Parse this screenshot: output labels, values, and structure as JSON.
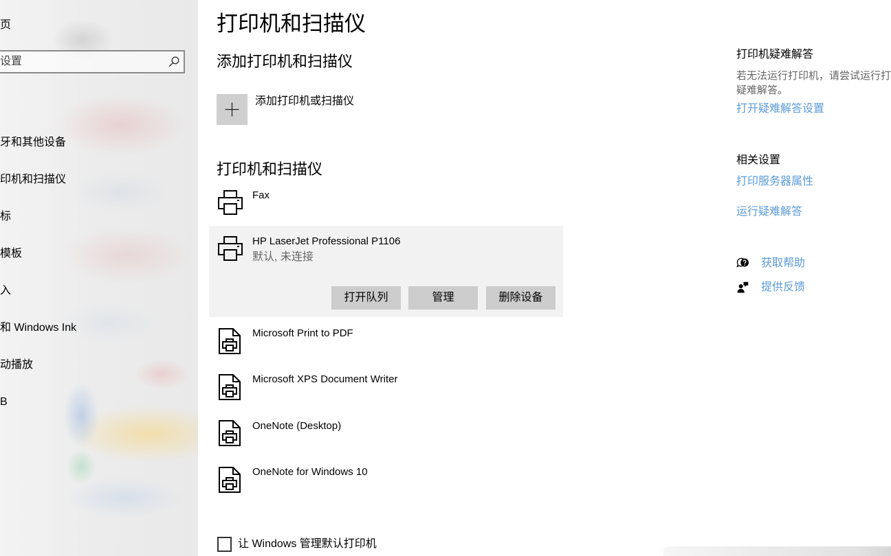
{
  "theme": {
    "link_color": "#5b9bd8",
    "secondary_text": "#666666",
    "button_bg": "#cccccc",
    "selected_row_bg": "#f2f2f2"
  },
  "sidebar": {
    "home_label": "页",
    "search": {
      "value": "",
      "placeholder": "设置",
      "icon": "search-icon"
    },
    "items": [
      {
        "label": "牙和其他设备"
      },
      {
        "label": "印机和扫描仪"
      },
      {
        "label": "标"
      },
      {
        "label": "模板"
      },
      {
        "label": "入"
      },
      {
        "label": "和 Windows Ink"
      },
      {
        "label": "动播放"
      },
      {
        "label": "B"
      }
    ]
  },
  "main": {
    "title": "打印机和扫描仪",
    "add_section": {
      "heading": "添加打印机和扫描仪",
      "add_label": "添加打印机或扫描仪",
      "add_icon": "plus-icon"
    },
    "devices_section": {
      "heading": "打印机和扫描仪",
      "devices": [
        {
          "name": "Fax",
          "icon": "printer-icon"
        },
        {
          "name": "HP LaserJet Professional P1106",
          "status": "默认, 未连接",
          "icon": "printer-icon",
          "selected": true
        },
        {
          "name": "Microsoft Print to PDF",
          "icon": "document-printer-icon"
        },
        {
          "name": "Microsoft XPS Document Writer",
          "icon": "document-printer-icon"
        },
        {
          "name": "OneNote (Desktop)",
          "icon": "document-printer-icon"
        },
        {
          "name": "OneNote for Windows 10",
          "icon": "document-printer-icon"
        }
      ],
      "selected_actions": {
        "open_queue": "打开队列",
        "manage": "管理",
        "remove_device": "删除设备"
      }
    },
    "default_printer_option": {
      "label": "让 Windows 管理默认打印机",
      "checked": false
    }
  },
  "aside": {
    "troubleshoot": {
      "heading": "打印机疑难解答",
      "description_line1": "若无法运行打印机，请尝试运行打",
      "description_line2": "疑难解答。",
      "link": "打开疑难解答设置"
    },
    "related": {
      "heading": "相关设置",
      "links": [
        "打印服务器属性",
        "运行疑难解答"
      ]
    },
    "help": [
      {
        "label": "获取帮助",
        "icon": "help-chat-icon"
      },
      {
        "label": "提供反馈",
        "icon": "feedback-icon"
      }
    ]
  }
}
